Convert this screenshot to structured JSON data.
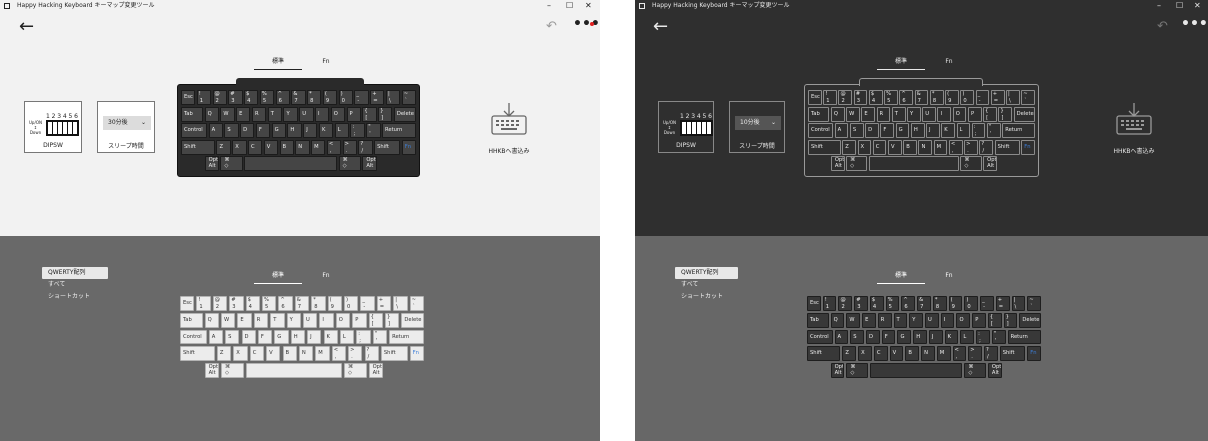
{
  "app": {
    "title": "Happy Hacking Keyboard キーマップ変更ツール",
    "window_controls": [
      "–",
      "☐",
      "✕"
    ]
  },
  "toolbar": {
    "back_icon": "←",
    "undo_icon": "↶",
    "more_icon": "•••"
  },
  "layer_tabs": [
    "標準",
    "Fn"
  ],
  "dipsw": {
    "up_label": "Up/ON",
    "down_label": "Down",
    "numbers": "123456",
    "caption": "DIPSW"
  },
  "sleep": {
    "left_value": "30分後",
    "right_value": "10分後",
    "chevron": "⌄",
    "caption": "スリープ時間"
  },
  "write": {
    "caption": "HHKBへ書込み"
  },
  "categories": [
    "QWERTY配列",
    "すべて",
    "ショートカット"
  ],
  "keys": {
    "r1": [
      "Esc",
      "1\n!",
      "2\n@",
      "3\n#",
      "4\n$",
      "5\n%",
      "6\n^",
      "7\n&",
      "8\n*",
      "9\n(",
      "0\n)",
      "-\n_",
      "=\n+",
      "\\\n|",
      "`\n~"
    ],
    "r2": [
      "Tab",
      "Q",
      "W",
      "E",
      "R",
      "T",
      "Y",
      "U",
      "I",
      "O",
      "P",
      "[\n{",
      "]\n}",
      "Delete"
    ],
    "r3": [
      "Control",
      "A",
      "S",
      "D",
      "F",
      "G",
      "H",
      "J",
      "K",
      "L",
      ";\n:",
      "'\n\"",
      "Return"
    ],
    "r4": [
      "Shift",
      "Z",
      "X",
      "C",
      "V",
      "B",
      "N",
      "M",
      ",\n<",
      ".\n>",
      "/\n?",
      "Shift",
      "Fn"
    ],
    "r5": [
      "Opt\nAlt",
      "⌘\n◇",
      "",
      "⌘\n◇",
      "Opt\nAlt"
    ]
  },
  "colors": {
    "accent_fn": "#3b7dd8",
    "notify_dot": "#e02020"
  }
}
